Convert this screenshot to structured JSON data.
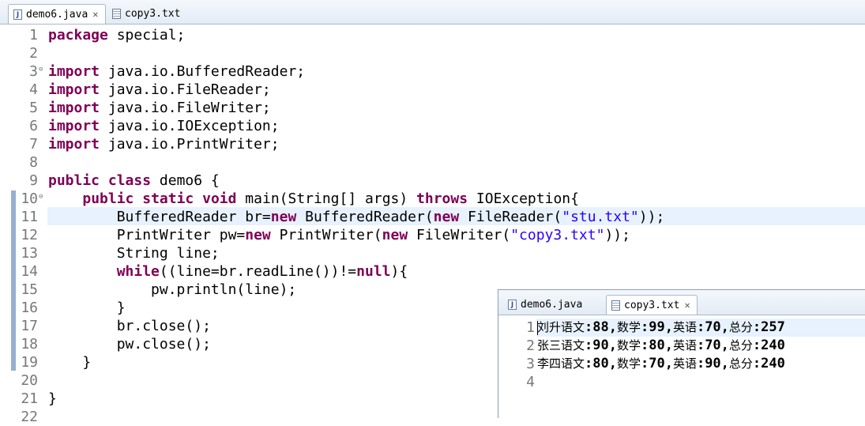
{
  "main_tabs": [
    {
      "label": "demo6.java",
      "type": "java",
      "active": true,
      "closable": true
    },
    {
      "label": "copy3.txt",
      "type": "text",
      "active": false,
      "closable": false
    }
  ],
  "editor": {
    "line_numbers": [
      "1",
      "2",
      "3",
      "4",
      "5",
      "6",
      "7",
      "8",
      "9",
      "10",
      "11",
      "12",
      "13",
      "14",
      "15",
      "16",
      "17",
      "18",
      "19",
      "20",
      "21",
      "22"
    ],
    "lines": [
      [
        [
          "k",
          "package"
        ],
        [
          "n",
          " special;"
        ]
      ],
      [],
      [
        [
          "k",
          "import"
        ],
        [
          "n",
          " java.io.BufferedReader;"
        ]
      ],
      [
        [
          "k",
          "import"
        ],
        [
          "n",
          " java.io.FileReader;"
        ]
      ],
      [
        [
          "k",
          "import"
        ],
        [
          "n",
          " java.io.FileWriter;"
        ]
      ],
      [
        [
          "k",
          "import"
        ],
        [
          "n",
          " java.io.IOException;"
        ]
      ],
      [
        [
          "k",
          "import"
        ],
        [
          "n",
          " java.io.PrintWriter;"
        ]
      ],
      [],
      [
        [
          "k",
          "public"
        ],
        [
          "n",
          " "
        ],
        [
          "k",
          "class"
        ],
        [
          "n",
          " demo6 {"
        ]
      ],
      [
        [
          "n",
          "    "
        ],
        [
          "k",
          "public"
        ],
        [
          "n",
          " "
        ],
        [
          "k",
          "static"
        ],
        [
          "n",
          " "
        ],
        [
          "k",
          "void"
        ],
        [
          "n",
          " main(String[] args) "
        ],
        [
          "k",
          "throws"
        ],
        [
          "n",
          " IOException{"
        ]
      ],
      [
        [
          "n",
          "        BufferedReader br="
        ],
        [
          "k",
          "new"
        ],
        [
          "n",
          " BufferedReader("
        ],
        [
          "k",
          "new"
        ],
        [
          "n",
          " FileReader("
        ],
        [
          "s",
          "\"stu.txt\""
        ],
        [
          "n",
          "));"
        ]
      ],
      [
        [
          "n",
          "        PrintWriter pw="
        ],
        [
          "k",
          "new"
        ],
        [
          "n",
          " PrintWriter("
        ],
        [
          "k",
          "new"
        ],
        [
          "n",
          " FileWriter("
        ],
        [
          "s",
          "\"copy3.txt\""
        ],
        [
          "n",
          "));"
        ]
      ],
      [
        [
          "n",
          "        String line;"
        ]
      ],
      [
        [
          "n",
          "        "
        ],
        [
          "k",
          "while"
        ],
        [
          "n",
          "((line=br.readLine())!="
        ],
        [
          "k",
          "null"
        ],
        [
          "n",
          "){"
        ]
      ],
      [
        [
          "n",
          "            pw.println(line);"
        ]
      ],
      [
        [
          "n",
          "        }"
        ]
      ],
      [
        [
          "n",
          "        br.close();"
        ]
      ],
      [
        [
          "n",
          "        pw.close();"
        ]
      ],
      [
        [
          "n",
          "    }"
        ]
      ],
      [],
      [
        [
          "n",
          "}"
        ]
      ],
      []
    ]
  },
  "float_window": {
    "tabs": [
      {
        "label": "demo6.java",
        "type": "java",
        "active": false,
        "closable": false
      },
      {
        "label": "copy3.txt",
        "type": "text",
        "active": true,
        "closable": true
      }
    ],
    "line_numbers": [
      "1",
      "2",
      "3",
      "4"
    ],
    "lines": [
      [
        [
          "c",
          "刘升语文"
        ],
        [
          "a",
          ":88,"
        ],
        [
          "c",
          "数学"
        ],
        [
          "a",
          ":99,"
        ],
        [
          "c",
          "英语"
        ],
        [
          "a",
          ":70,"
        ],
        [
          "c",
          "总分"
        ],
        [
          "a",
          ":257"
        ]
      ],
      [
        [
          "c",
          "张三语文"
        ],
        [
          "a",
          ":90,"
        ],
        [
          "c",
          "数学"
        ],
        [
          "a",
          ":80,"
        ],
        [
          "c",
          "英语"
        ],
        [
          "a",
          ":70,"
        ],
        [
          "c",
          "总分"
        ],
        [
          "a",
          ":240"
        ]
      ],
      [
        [
          "c",
          "李四语文"
        ],
        [
          "a",
          ":80,"
        ],
        [
          "c",
          "数学"
        ],
        [
          "a",
          ":70,"
        ],
        [
          "c",
          "英语"
        ],
        [
          "a",
          ":90,"
        ],
        [
          "c",
          "总分"
        ],
        [
          "a",
          ":240"
        ]
      ],
      []
    ]
  }
}
